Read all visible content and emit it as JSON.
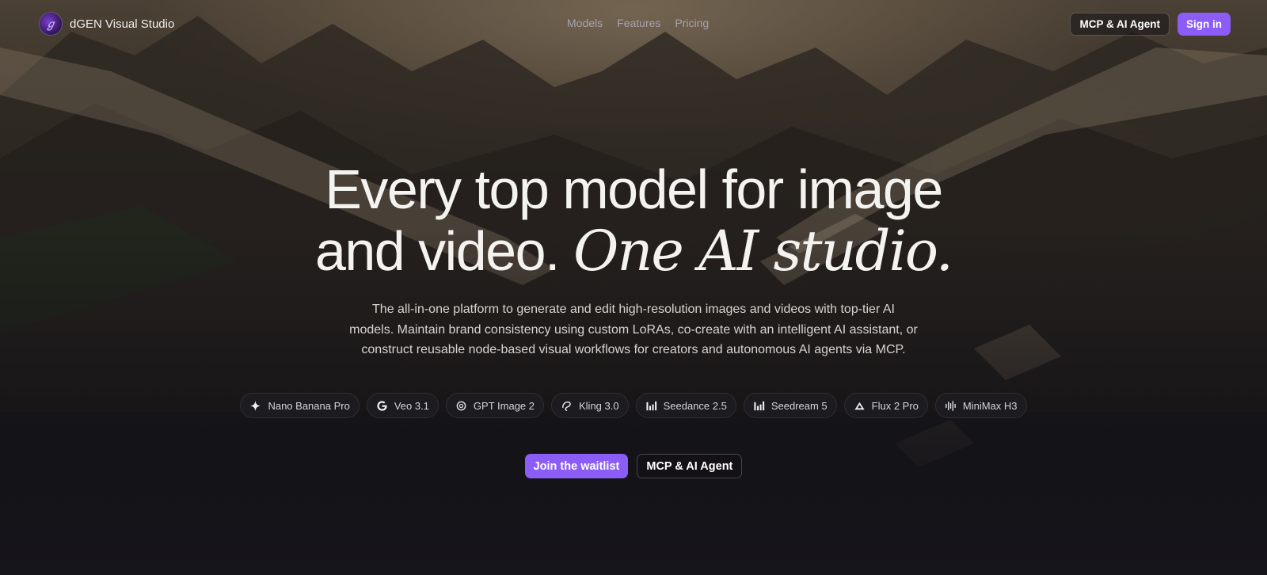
{
  "brand": {
    "name": "dGEN Visual Studio",
    "logo_icon": "dgen-logo-icon"
  },
  "nav": {
    "links": [
      "Models",
      "Features",
      "Pricing"
    ],
    "mcp_button": "MCP & AI Agent",
    "signin_button": "Sign in"
  },
  "hero": {
    "headline_line1": "Every top model for image",
    "headline_line2_plain": "and video.",
    "headline_line2_serif": "One AI studio.",
    "subtext": "The all-in-one platform to generate and edit high-resolution images and videos with top-tier AI models. Maintain brand consistency using custom LoRAs, co-create with an intelligent AI assistant, or construct reusable node-based visual workflows for creators and autonomous AI agents via MCP."
  },
  "models": [
    {
      "label": "Nano Banana Pro",
      "icon": "sparkle-icon"
    },
    {
      "label": "Veo 3.1",
      "icon": "google-icon"
    },
    {
      "label": "GPT Image 2",
      "icon": "openai-icon"
    },
    {
      "label": "Kling 3.0",
      "icon": "kling-icon"
    },
    {
      "label": "Seedance 2.5",
      "icon": "bars-icon"
    },
    {
      "label": "Seedream 5",
      "icon": "bars-icon"
    },
    {
      "label": "Flux 2 Pro",
      "icon": "flux-icon"
    },
    {
      "label": "MiniMax H3",
      "icon": "waveform-icon"
    }
  ],
  "ctas": {
    "waitlist": "Join the waitlist",
    "mcp": "MCP & AI Agent"
  },
  "colors": {
    "accent": "#8b5cf6",
    "background": "#16151b"
  }
}
